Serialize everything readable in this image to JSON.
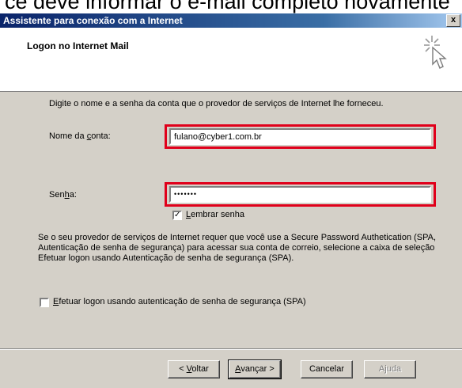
{
  "caption": "ce deve informar o e-mail completo novamente",
  "window": {
    "title": "Assistente para conexão com a Internet",
    "close_label": "x"
  },
  "header": {
    "title": "Logon no Internet Mail"
  },
  "main": {
    "intro": "Digite o nome e a senha da conta que o provedor de serviços de Internet lhe forneceu.",
    "account": {
      "label_pre": "Nome da ",
      "label_u": "c",
      "label_post": "onta:",
      "value": "fulano@cyber1.com.br"
    },
    "password": {
      "label_pre": "Sen",
      "label_u": "h",
      "label_post": "a:",
      "value": "•••••••"
    },
    "remember": {
      "checked": true,
      "mark": "✓",
      "label_u": "L",
      "label_post": "embrar senha"
    },
    "spa_info": "Se o seu provedor de serviços de Internet requer que você use a Secure Password Authetication (SPA, Autenticação de senha de segurança) para acessar sua conta de correio, selecione a caixa de seleção Efetuar logon usando Autenticação de senha de segurança (SPA).",
    "spa_checkbox": {
      "checked": false,
      "label_u": "E",
      "label_post": "fetuar logon usando autenticação de senha de segurança (SPA)"
    }
  },
  "footer": {
    "back_u": "V",
    "back_pre": "< ",
    "back_post": "oltar",
    "next_u": "A",
    "next_post": "vançar >",
    "cancel": "Cancelar",
    "help": "Ajuda"
  },
  "colors": {
    "highlight": "#e0001b",
    "titlebar_start": "#0a246a",
    "dialog_bg": "#d4d0c8"
  }
}
